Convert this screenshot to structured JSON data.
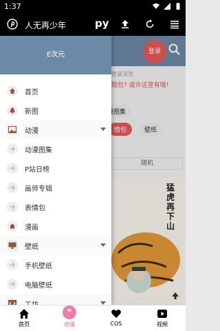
{
  "status": {
    "time": "1:37"
  },
  "appbar": {
    "title": "人无再少年",
    "py_label": "py",
    "icons": [
      "pinterest-p-icon",
      "upload-icon",
      "refresh-icon",
      "menu-lines-icon"
    ]
  },
  "background": {
    "login_label": "登录",
    "notice_line1": "登录浏览",
    "notice_line2": "酷包? 或许这里有哦!",
    "chips": [
      {
        "label": "漫图集",
        "active": false
      },
      {
        "label": "情包",
        "active": true
      },
      {
        "label": "壁纸",
        "active": false
      }
    ],
    "random_label": "随机",
    "poster_text": "猛虎再下山"
  },
  "drawer": {
    "header_title": "E次元",
    "items": [
      {
        "label": "首页",
        "icon": "home-icon",
        "type": "top"
      },
      {
        "label": "新图",
        "icon": "bell-icon",
        "type": "top"
      },
      {
        "label": "动漫",
        "icon": "image-icon",
        "type": "group"
      },
      {
        "label": "动漫图集",
        "icon": "arrow-right-icon",
        "type": "sub"
      },
      {
        "label": "P站日榜",
        "icon": "arrow-right-icon",
        "type": "sub"
      },
      {
        "label": "画师专辑",
        "icon": "arrow-right-icon",
        "type": "sub"
      },
      {
        "label": "表情包",
        "icon": "arrow-right-icon",
        "type": "sub"
      },
      {
        "label": "漫画",
        "icon": "ghost-icon",
        "type": "top"
      },
      {
        "label": "壁纸",
        "icon": "monitor-icon",
        "type": "group"
      },
      {
        "label": "手机壁纸",
        "icon": "arrow-right-icon",
        "type": "sub"
      },
      {
        "label": "电脑壁纸",
        "icon": "arrow-right-icon",
        "type": "sub"
      },
      {
        "label": "工坊",
        "icon": "code-icon",
        "type": "group"
      }
    ]
  },
  "bottomnav": {
    "items": [
      {
        "label": "首页",
        "icon": "home-icon",
        "active": false
      },
      {
        "label": "动漫",
        "icon": "quote-bubble-icon",
        "active": true
      },
      {
        "label": "COS",
        "icon": "heart-icon",
        "active": false
      },
      {
        "label": "视频",
        "icon": "play-icon",
        "active": false
      }
    ]
  },
  "colors": {
    "accent": "#e85a5a",
    "header": "#6b8aa6",
    "nav_active": "#ef5b8b"
  }
}
